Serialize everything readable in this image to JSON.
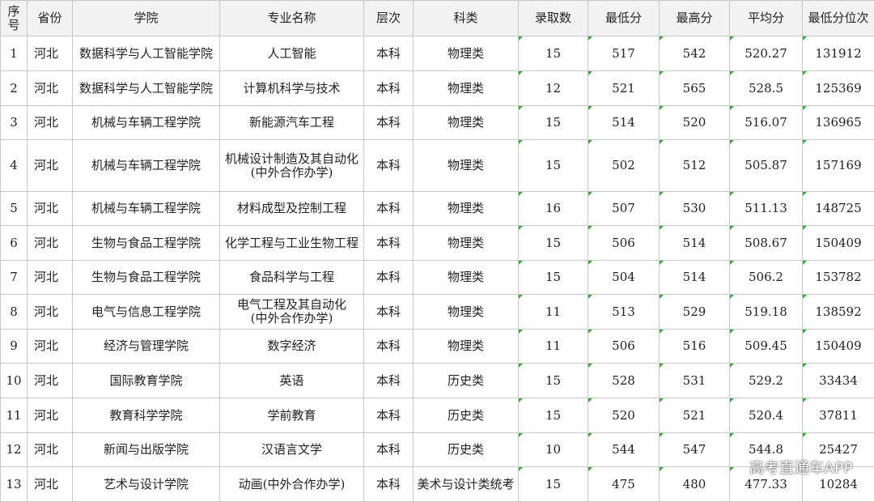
{
  "table": {
    "headers": [
      "序号",
      "省份",
      "学院",
      "专业名称",
      "层次",
      "科类",
      "录取数",
      "最低分",
      "最高分",
      "平均分",
      "最低分位次"
    ],
    "rows": [
      [
        "1",
        "河北",
        "数据科学与人工智能学院",
        "人工智能",
        "本科",
        "物理类",
        "15",
        "517",
        "542",
        "520.27",
        "131912"
      ],
      [
        "2",
        "河北",
        "数据科学与人工智能学院",
        "计算机科学与技术",
        "本科",
        "物理类",
        "12",
        "521",
        "565",
        "528.5",
        "125369"
      ],
      [
        "3",
        "河北",
        "机械与车辆工程学院",
        "新能源汽车工程",
        "本科",
        "物理类",
        "15",
        "514",
        "520",
        "516.07",
        "136965"
      ],
      [
        "4",
        "河北",
        "机械与车辆工程学院",
        "机械设计制造及其自动化\n(中外合作办学)",
        "本科",
        "物理类",
        "15",
        "502",
        "512",
        "505.87",
        "157169"
      ],
      [
        "5",
        "河北",
        "机械与车辆工程学院",
        "材料成型及控制工程",
        "本科",
        "物理类",
        "16",
        "507",
        "530",
        "511.13",
        "148725"
      ],
      [
        "6",
        "河北",
        "生物与食品工程学院",
        "化学工程与工业生物工程",
        "本科",
        "物理类",
        "15",
        "506",
        "514",
        "508.67",
        "150409"
      ],
      [
        "7",
        "河北",
        "生物与食品工程学院",
        "食品科学与工程",
        "本科",
        "物理类",
        "15",
        "504",
        "514",
        "506.2",
        "153782"
      ],
      [
        "8",
        "河北",
        "电气与信息工程学院",
        "电气工程及其自动化\n(中外合作办学)",
        "本科",
        "物理类",
        "11",
        "513",
        "529",
        "519.18",
        "138592"
      ],
      [
        "9",
        "河北",
        "经济与管理学院",
        "数字经济",
        "本科",
        "物理类",
        "11",
        "506",
        "516",
        "509.45",
        "150409"
      ],
      [
        "10",
        "河北",
        "国际教育学院",
        "英语",
        "本科",
        "历史类",
        "15",
        "528",
        "531",
        "529.2",
        "33434"
      ],
      [
        "11",
        "河北",
        "教育科学学院",
        "学前教育",
        "本科",
        "历史类",
        "15",
        "520",
        "521",
        "520.4",
        "37811"
      ],
      [
        "12",
        "河北",
        "新闻与出版学院",
        "汉语言文学",
        "本科",
        "历史类",
        "10",
        "544",
        "547",
        "544.8",
        "25427"
      ],
      [
        "13",
        "河北",
        "艺术与设计学院",
        "动画(中外合作办学)",
        "本科",
        "美术与设计类统考",
        "15",
        "475",
        "480",
        "477.33",
        "10284"
      ]
    ]
  },
  "watermark": "高考直通车APP"
}
